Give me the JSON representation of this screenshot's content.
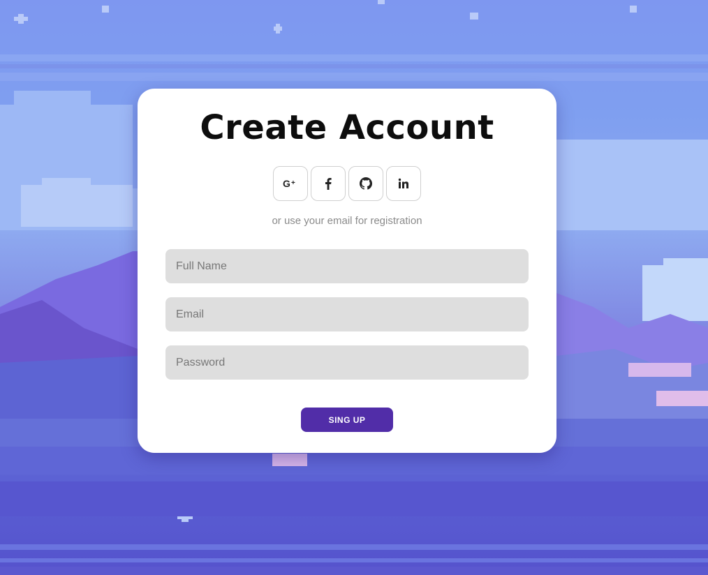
{
  "form": {
    "title": "Create Account",
    "social_buttons": [
      {
        "name": "google-plus",
        "label": "G+"
      },
      {
        "name": "facebook",
        "label": "f"
      },
      {
        "name": "github",
        "label": ""
      },
      {
        "name": "linkedin",
        "label": "in"
      }
    ],
    "divider_text": "or use your email for registration",
    "fields": {
      "name_placeholder": "Full Name",
      "email_placeholder": "Email",
      "password_placeholder": "Password"
    },
    "submit_label": "SING UP"
  },
  "colors": {
    "accent": "#512da8",
    "card": "#ffffff",
    "input_bg": "#dedede",
    "sky": "#7f9ff0"
  },
  "icons": [
    "google-plus-icon",
    "facebook-icon",
    "github-icon",
    "linkedin-icon"
  ]
}
